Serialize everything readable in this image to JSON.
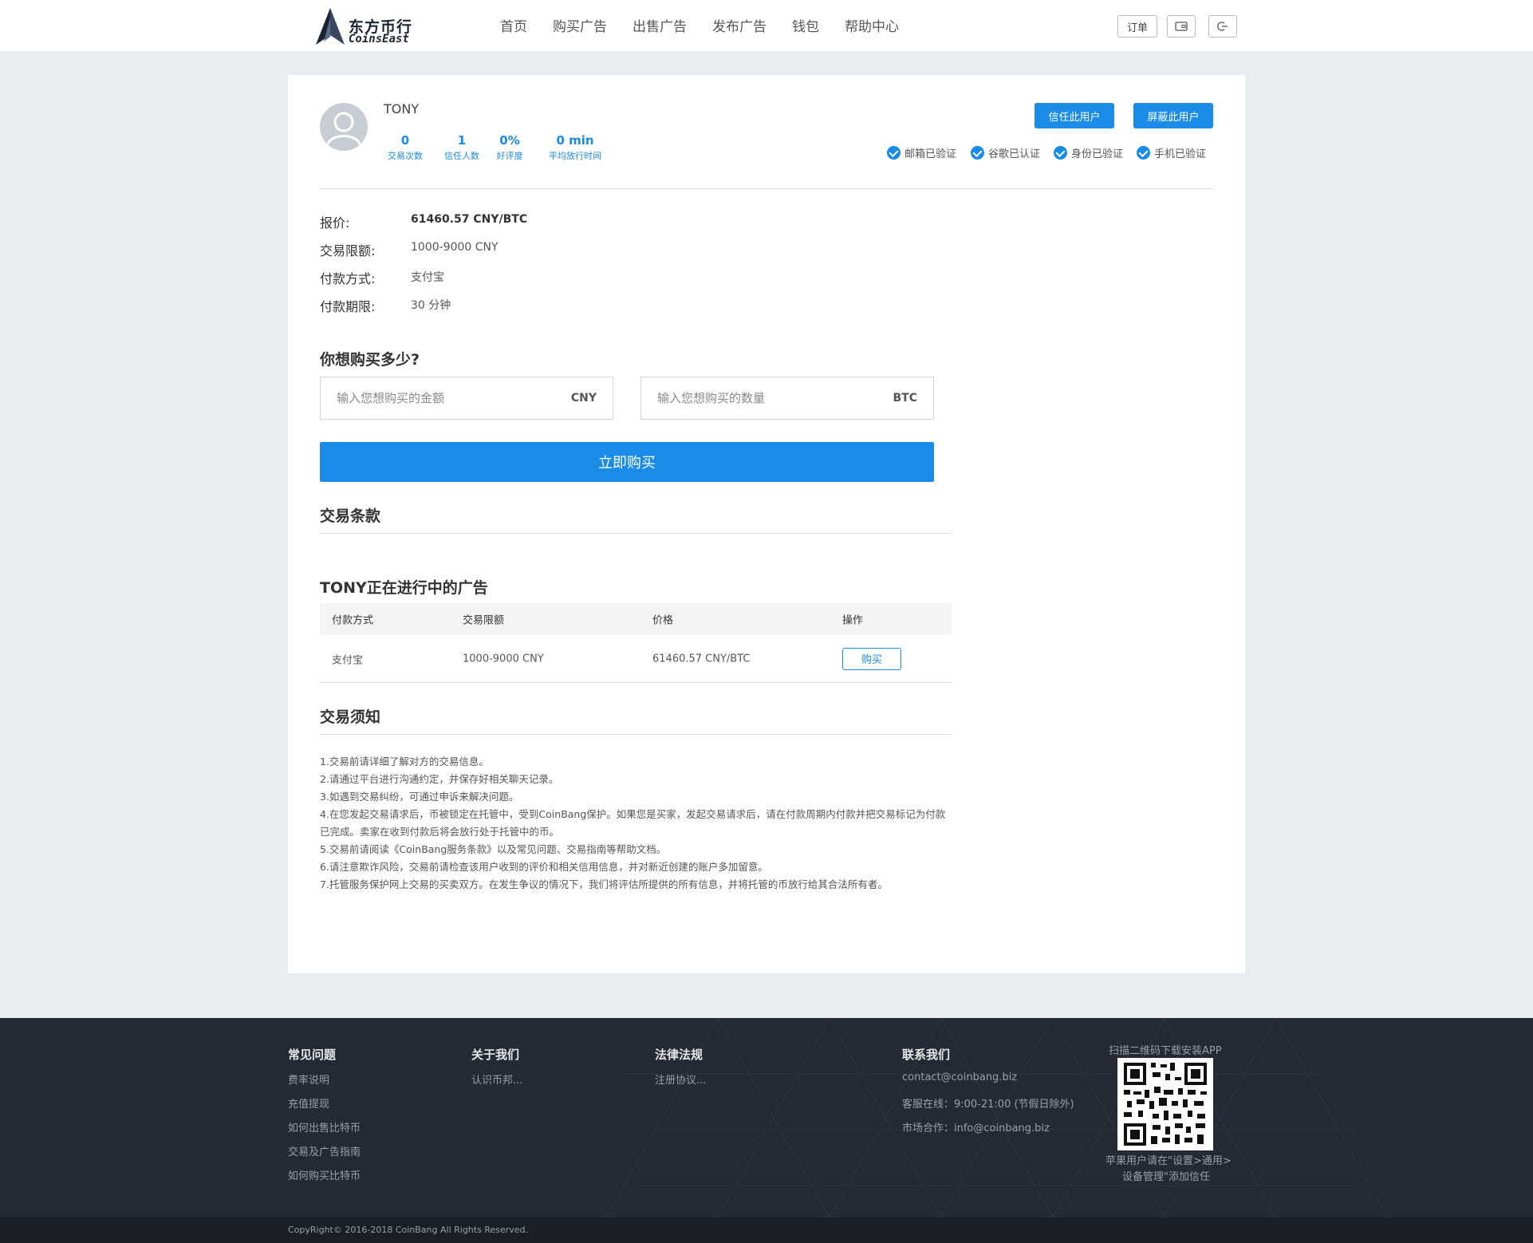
{
  "header": {
    "logo_cn": "东方币行",
    "logo_en": "CoinsEast",
    "nav": [
      "首页",
      "购买广告",
      "出售广告",
      "发布广告",
      "钱包",
      "帮助中心"
    ],
    "orders_label": "订单"
  },
  "profile": {
    "username": "TONY",
    "stats": [
      {
        "value": "0",
        "label": "交易次数"
      },
      {
        "value": "1",
        "label": "信任人数"
      },
      {
        "value": "0%",
        "label": "好评度"
      },
      {
        "value": "0 min",
        "label": "平均放行时间"
      }
    ],
    "trust_button": "信任此用户",
    "block_button": "屏蔽此用户",
    "verifications": [
      "邮箱已验证",
      "谷歌已认证",
      "身份已验证",
      "手机已验证"
    ]
  },
  "offer": {
    "price_label": "报价:",
    "price_value": "61460.57 CNY/BTC",
    "limit_label": "交易限额:",
    "limit_value": "1000-9000 CNY",
    "payment_label": "付款方式:",
    "payment_value": "支付宝",
    "period_label": "付款期限:",
    "period_value": "30 分钟"
  },
  "buy": {
    "title": "你想购买多少?",
    "amount_placeholder": "输入您想购买的金额",
    "amount_unit": "CNY",
    "qty_placeholder": "输入您想购买的数量",
    "qty_unit": "BTC",
    "button": "立即购买"
  },
  "terms_title": "交易条款",
  "ads": {
    "title": "TONY正在进行中的广告",
    "columns": [
      "付款方式",
      "交易限额",
      "价格",
      "操作"
    ],
    "rows": [
      {
        "payment": "支付宝",
        "limit": "1000-9000 CNY",
        "price": "61460.57 CNY/BTC",
        "action": "购买"
      }
    ]
  },
  "notice": {
    "title": "交易须知",
    "lines": [
      "1.交易前请详细了解对方的交易信息。",
      "2.请通过平台进行沟通约定，并保存好相关聊天记录。",
      "3.如遇到交易纠纷，可通过申诉来解决问题。",
      "4.在您发起交易请求后，币被锁定在托管中，受到CoinBang保护。如果您是买家，发起交易请求后，请在付款周期内付款并把交易标记为付款已完成。卖家在收到付款后将会放行处于托管中的币。",
      "5.交易前请阅读《CoinBang服务条款》以及常见问题、交易指南等帮助文档。",
      "6.请注意欺诈风险，交易前请检查该用户收到的评价和相关信用信息，并对新近创建的账户多加留意。",
      "7.托管服务保护网上交易的买卖双方。在发生争议的情况下，我们将评估所提供的所有信息，并将托管的币放行给其合法所有者。"
    ]
  },
  "footer": {
    "faq_title": "常见问题",
    "faq_links": [
      "费率说明",
      "充值提现",
      "如何出售比特币",
      "交易及广告指南",
      "如何购买比特币"
    ],
    "about_title": "关于我们",
    "about_links": [
      "认识币邦..."
    ],
    "legal_title": "法律法规",
    "legal_links": [
      "注册协议..."
    ],
    "contact_title": "联系我们",
    "contact_lines": [
      "contact@coinbang.biz",
      "客服在线：9:00-21:00 (节假日除外)",
      "市场合作：info@coinbang.biz"
    ],
    "qr_caption": "扫描二维码下载安装APP",
    "apple_note_1": "苹果用户请在\"设置>通用>",
    "apple_note_2": "设备管理\"添加信任",
    "copyright": "CopyRight© 2016-2018 CoinBang All Rights Reserved."
  }
}
